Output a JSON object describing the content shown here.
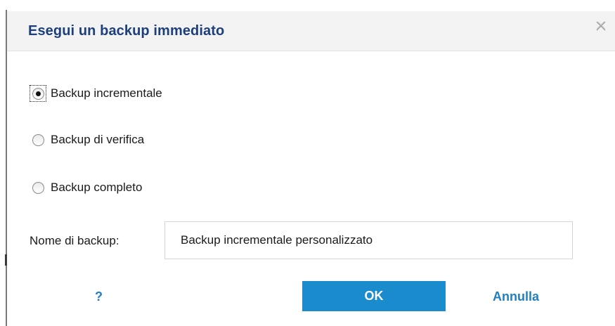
{
  "dialog": {
    "title": "Esegui un backup immediato",
    "close_icon": "close-icon"
  },
  "backup_type": {
    "selected": "incremental",
    "options": [
      {
        "id": "incremental",
        "label": "Backup incrementale",
        "checked": true
      },
      {
        "id": "verify",
        "label": "Backup di verifica",
        "checked": false
      },
      {
        "id": "full",
        "label": "Backup completo",
        "checked": false
      }
    ]
  },
  "backup_name": {
    "label": "Nome di backup:",
    "value": "Backup incrementale personalizzato"
  },
  "footer": {
    "help_label": "?",
    "ok_label": "OK",
    "cancel_label": "Annulla"
  },
  "colors": {
    "title": "#1d3f7a",
    "title_bar_bg": "#f3f3f3",
    "accent": "#1a8bcd",
    "link": "#1f7fc0"
  }
}
